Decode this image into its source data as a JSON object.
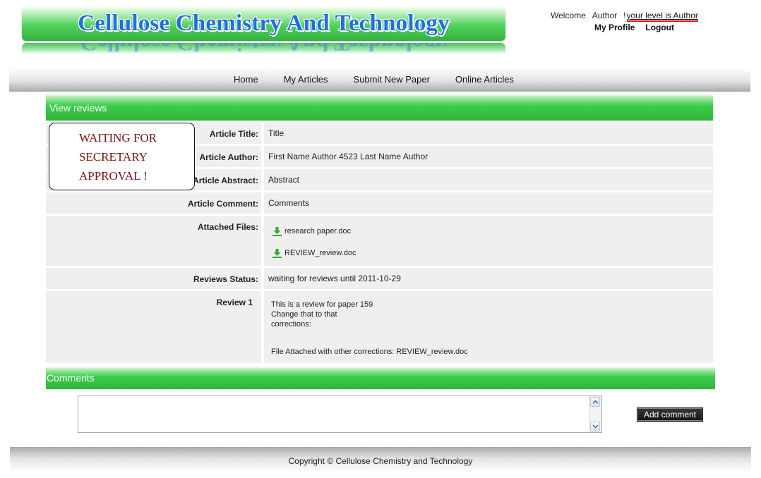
{
  "header": {
    "site_title": "Cellulose Chemistry And Technology",
    "welcome_label": "Welcome",
    "user_name": "Author",
    "exclamation": "!",
    "level_text": "your level is Author",
    "my_profile": "My Profile",
    "logout": "Logout"
  },
  "nav": {
    "items": [
      "Home",
      "My Articles",
      "Submit New Paper",
      "Online Articles"
    ]
  },
  "review_panel": {
    "title": "View reviews",
    "stamp_lines": [
      "WAITING FOR",
      "SECRETARY",
      "APPROVAL !"
    ],
    "article_title_label": "Article Title:",
    "article_title": "Title",
    "article_author_label": "Article Author:",
    "article_author": "First Name Author 4523 Last Name Author",
    "article_abstract_label": "Article Abstract:",
    "article_abstract": "Abstract",
    "article_comment_label": "Article Comment:",
    "article_comment": "Comments",
    "attached_files_label": "Attached Files:",
    "attached_files": [
      "research paper.doc",
      "REVIEW_review.doc"
    ],
    "reviews_status_label": "Reviews Status:",
    "reviews_status": "waiting for reviews until 2011-10-29",
    "review_label": "Review 1",
    "review_text": "This is a review  for paper   159\nChange that to that\ncorrections:",
    "review_file_line": "File Attached with other corrections: REVIEW_review.doc"
  },
  "comments": {
    "title": "Comments",
    "textarea_value": "",
    "add_button": "Add comment"
  },
  "footer": {
    "copyright": "Copyright © Cellulose Chemistry and Technology"
  },
  "colors": {
    "green_bar": "#3ccc4d",
    "logo_text": "#1f6ee0",
    "stamp_text": "#7a0f0f",
    "level_underline": "#e0101a"
  }
}
